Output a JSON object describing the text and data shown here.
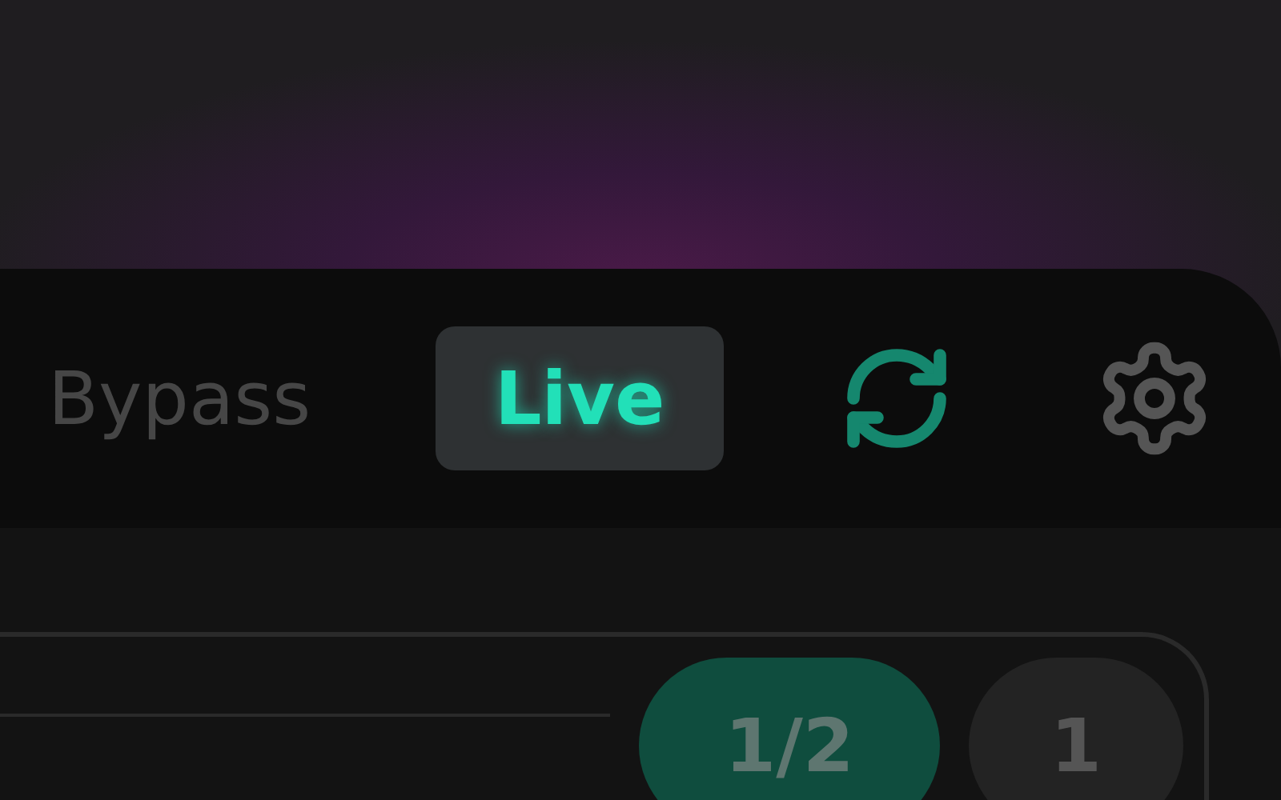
{
  "modes": [
    {
      "label": "Bypass",
      "selected": false
    },
    {
      "label": "Live",
      "selected": true
    }
  ],
  "rates": [
    {
      "label": "1/2",
      "selected": true
    },
    {
      "label": "1",
      "selected": false
    }
  ]
}
